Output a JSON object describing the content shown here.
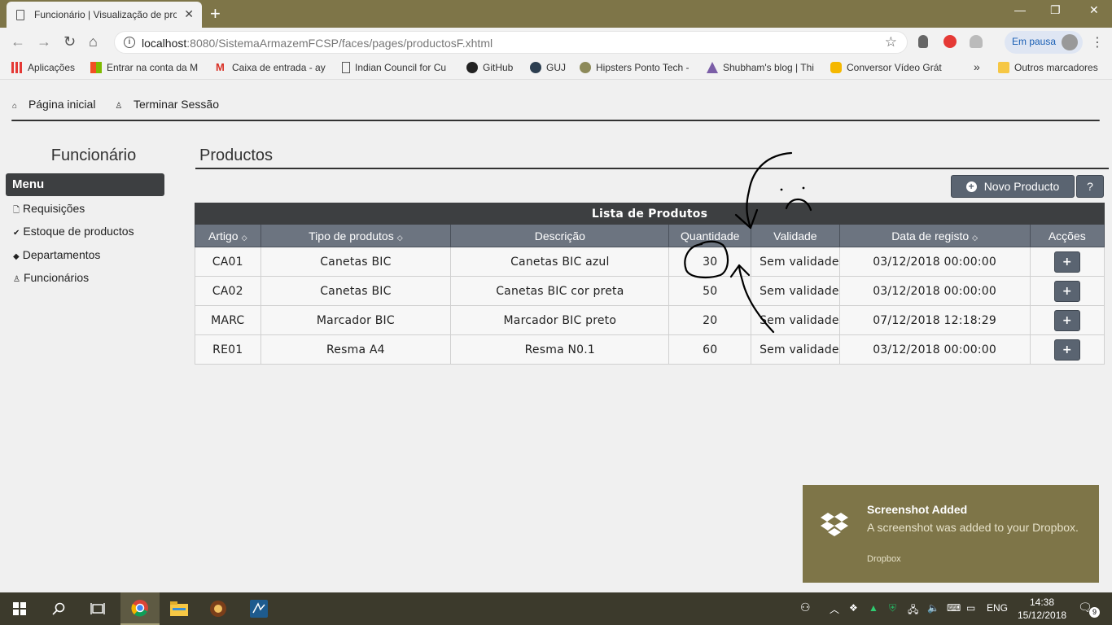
{
  "browser": {
    "tab_title": "Funcionário | Visualização de pro",
    "url_host": "localhost",
    "url_rest": ":8080/SistemaArmazemFCSP/faces/pages/productosF.xhtml",
    "profile_label": "Em pausa"
  },
  "bookmarks": [
    {
      "label": "Aplicações",
      "icon": "apps-icon"
    },
    {
      "label": "Entrar na conta da M",
      "icon": "microsoft-icon"
    },
    {
      "label": "Caixa de entrada - ay",
      "icon": "gmail-icon"
    },
    {
      "label": "Indian Council for Cu",
      "icon": "page-icon"
    },
    {
      "label": "GitHub",
      "icon": "github-icon"
    },
    {
      "label": "GUJ",
      "icon": "guj-icon"
    },
    {
      "label": "Hipsters Ponto Tech -",
      "icon": "hipsters-icon"
    },
    {
      "label": "Shubham's blog | Thi",
      "icon": "blog-icon"
    },
    {
      "label": "Conversor Vídeo Grát",
      "icon": "converter-icon"
    },
    {
      "label": "Outros marcadores",
      "icon": "folder-icon"
    }
  ],
  "topnav": {
    "home": "Página inicial",
    "logout": "Terminar Sessão"
  },
  "sidebar": {
    "title": "Funcionário",
    "menu_label": "Menu",
    "items": [
      {
        "label": "Requisições",
        "icon": "document-icon"
      },
      {
        "label": "Estoque de productos",
        "icon": "check-icon"
      },
      {
        "label": "Departamentos",
        "icon": "tag-icon"
      },
      {
        "label": "Funcionários",
        "icon": "user-icon"
      }
    ]
  },
  "main": {
    "title": "Productos",
    "new_button": "Novo Producto",
    "help_button": "?",
    "table_caption": "Lista de Produtos",
    "columns": [
      "Artigo",
      "Tipo de produtos",
      "Descrição",
      "Quantidade",
      "Validade",
      "Data de registo",
      "Acções"
    ],
    "rows": [
      {
        "artigo": "CA01",
        "tipo": "Canetas BIC",
        "descricao": "Canetas BIC azul",
        "quantidade": "30",
        "validade": "Sem validade",
        "data": "03/12/2018 00:00:00",
        "acao": "+"
      },
      {
        "artigo": "CA02",
        "tipo": "Canetas BIC",
        "descricao": "Canetas BIC cor preta",
        "quantidade": "50",
        "validade": "Sem validade",
        "data": "03/12/2018 00:00:00",
        "acao": "+"
      },
      {
        "artigo": "MARC",
        "tipo": "Marcador BIC",
        "descricao": "Marcador BIC preto",
        "quantidade": "20",
        "validade": "Sem validade",
        "data": "07/12/2018 12:18:29",
        "acao": "+"
      },
      {
        "artigo": "RE01",
        "tipo": "Resma A4",
        "descricao": "Resma N0.1",
        "quantidade": "60",
        "validade": "Sem validade",
        "data": "03/12/2018 00:00:00",
        "acao": "+"
      }
    ]
  },
  "toast": {
    "title": "Screenshot Added",
    "body": "A screenshot was added to your Dropbox.",
    "source": "Dropbox"
  },
  "taskbar": {
    "lang": "ENG",
    "time": "14:38",
    "date": "15/12/2018",
    "notifications": "9"
  }
}
